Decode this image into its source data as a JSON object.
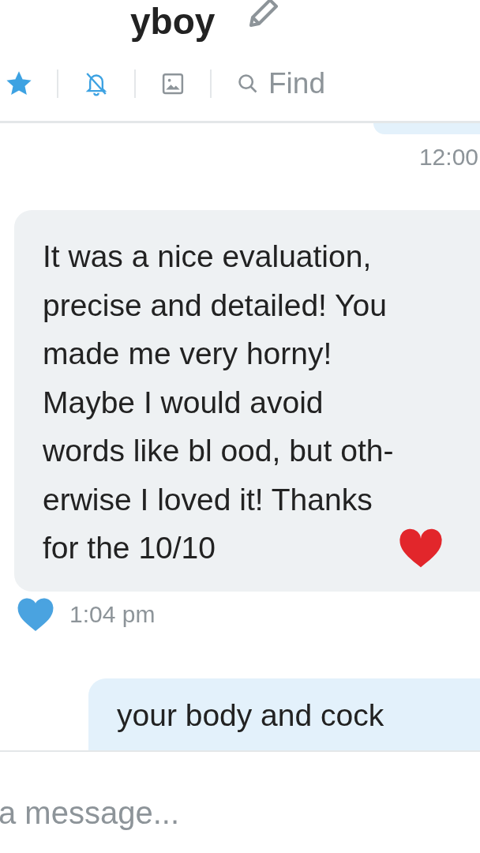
{
  "header": {
    "title": "yboy"
  },
  "toolbar": {
    "favorite": {
      "on": true
    },
    "mute": {
      "on": true
    },
    "search": {
      "label": "Find"
    }
  },
  "messages": [
    {
      "kind": "sent",
      "time": "12:00"
    },
    {
      "kind": "received",
      "text": "It was a nice evaluation,\nprecise and detailed! You\nmade me very horny!\nMaybe I would avoid\nwords like bl ood, but oth-\nerwise I loved it! Thanks\nfor the 10/10",
      "liked": true,
      "time": "1:04 pm"
    },
    {
      "kind": "sent",
      "text": "your body and cock"
    }
  ],
  "composer": {
    "placeholder": "a message..."
  }
}
